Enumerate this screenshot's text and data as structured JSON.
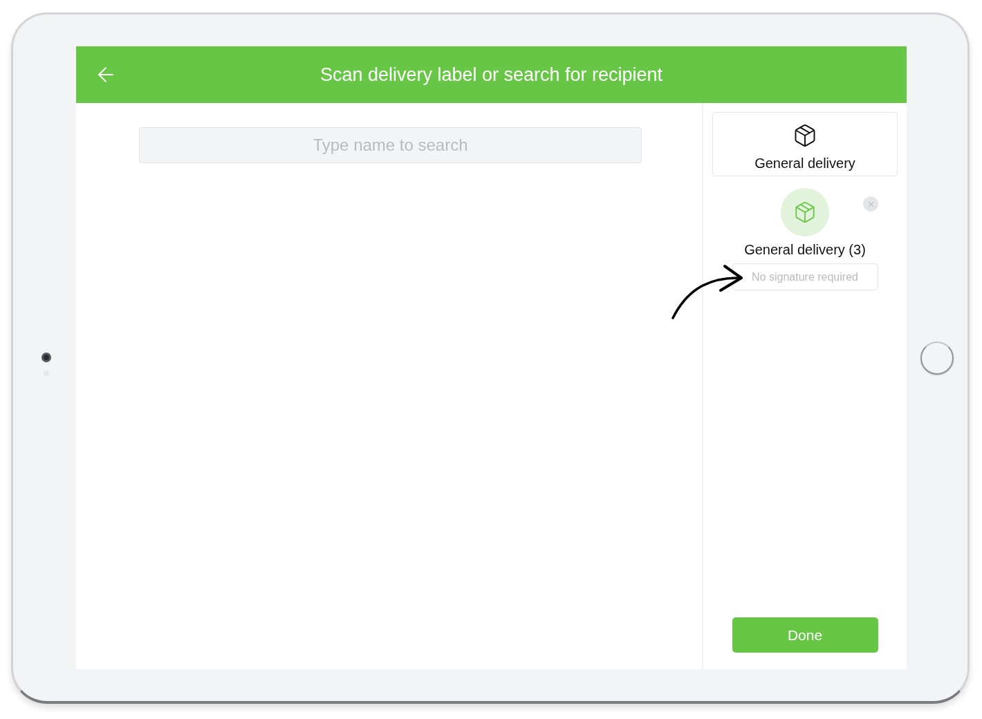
{
  "header": {
    "title": "Scan delivery label or search for recipient"
  },
  "search": {
    "placeholder": "Type name to search"
  },
  "delivery_options": [
    {
      "label": "General delivery"
    }
  ],
  "selected_delivery": {
    "label": "General delivery (3)",
    "signature_option": "No signature required"
  },
  "done_button": {
    "label": "Done"
  }
}
